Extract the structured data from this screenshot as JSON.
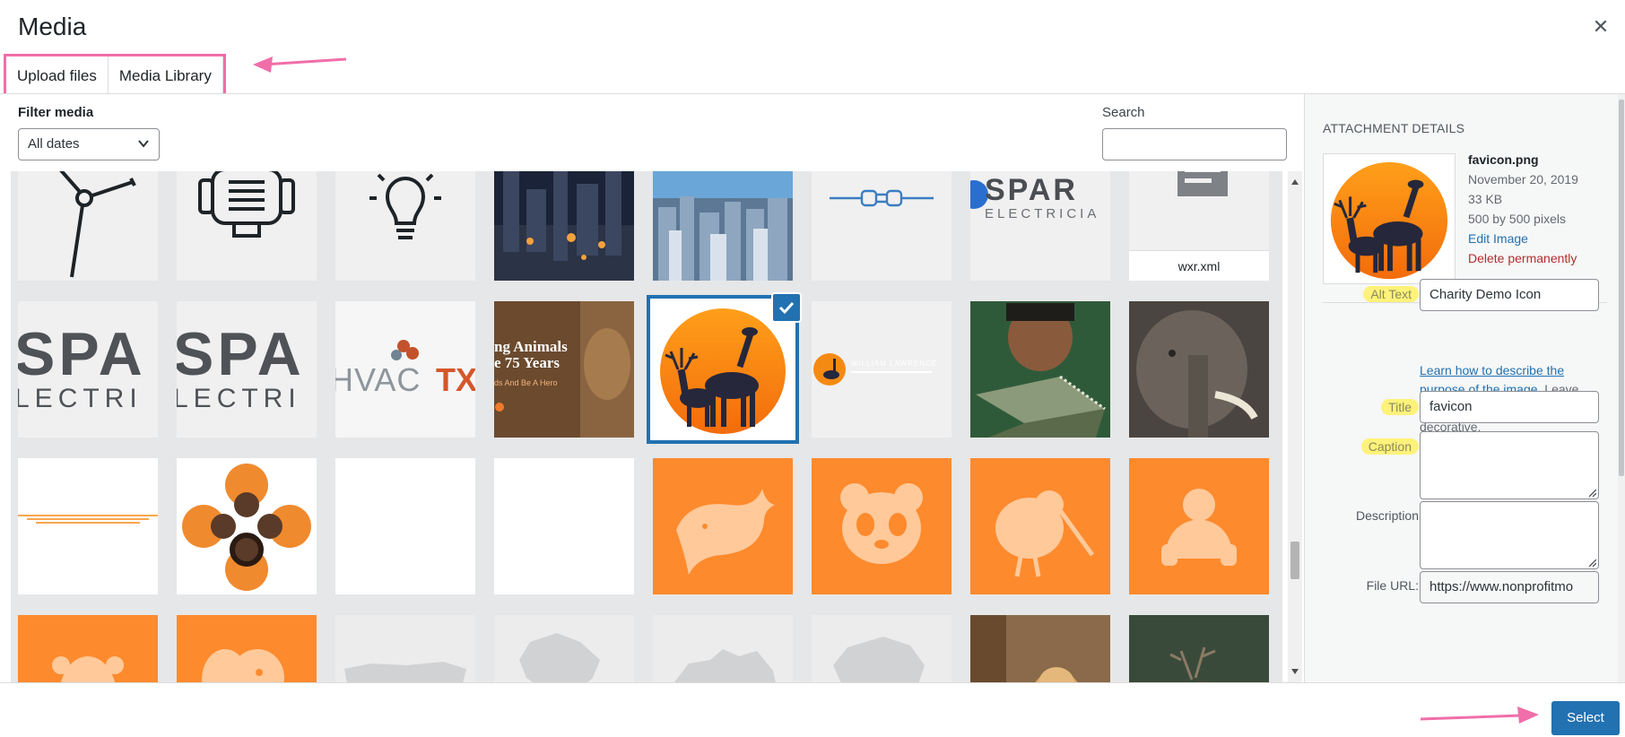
{
  "modal": {
    "title": "Media",
    "close_icon": "close-icon"
  },
  "tabs": [
    {
      "label": "Upload files",
      "active": false
    },
    {
      "label": "Media Library",
      "active": true
    }
  ],
  "annotations": {
    "arrow_color": "#f06ea9"
  },
  "toolbar": {
    "filter_label": "Filter media",
    "date_filter_value": "All dates",
    "search_label": "Search",
    "search_value": ""
  },
  "grid": {
    "items": [
      {
        "kind": "wind-turbine-icon"
      },
      {
        "kind": "server-icon"
      },
      {
        "kind": "lightbulb-icon"
      },
      {
        "kind": "city-night-photo"
      },
      {
        "kind": "city-skyline-photo"
      },
      {
        "kind": "plug-icon"
      },
      {
        "kind": "spar-logo",
        "text": "SPAR",
        "sub": "ELECTRICIA"
      },
      {
        "kind": "file",
        "filename": "wxr.xml"
      },
      {
        "kind": "spar-crop",
        "text": "SPA",
        "sub": "LECTRI"
      },
      {
        "kind": "spar-crop",
        "text": "SPA",
        "sub": "LECTRI"
      },
      {
        "kind": "hvactx-logo",
        "text": "HVACTX"
      },
      {
        "kind": "lion-website",
        "line1": "ng Animals",
        "line2": "e 75 Years",
        "line3": "ds And Be A Hero"
      },
      {
        "kind": "favicon-giraffe",
        "selected": true
      },
      {
        "kind": "wide-logo",
        "text": "WILLIAM LAWRENCE"
      },
      {
        "kind": "crocodile-photo"
      },
      {
        "kind": "elephant-photo"
      },
      {
        "kind": "divider-lines"
      },
      {
        "kind": "people-circle-photo"
      },
      {
        "kind": "blank"
      },
      {
        "kind": "blank"
      },
      {
        "kind": "animal-whale-icon"
      },
      {
        "kind": "animal-panda-icon"
      },
      {
        "kind": "animal-kiwi-icon"
      },
      {
        "kind": "animal-gorilla-icon"
      },
      {
        "kind": "animal-giraffe-icon"
      },
      {
        "kind": "animal-elephant-icon"
      },
      {
        "kind": "map-usa"
      },
      {
        "kind": "map-india"
      },
      {
        "kind": "map-australia"
      },
      {
        "kind": "map-africa"
      },
      {
        "kind": "lioness-photo"
      },
      {
        "kind": "deer-photo"
      }
    ]
  },
  "attachment": {
    "heading": "ATTACHMENT DETAILS",
    "filename": "favicon.png",
    "date": "November 20, 2019",
    "size": "33 KB",
    "dimensions": "500 by 500 pixels",
    "edit_label": "Edit Image",
    "delete_label": "Delete permanently",
    "alt_label": "Alt Text",
    "alt_value": "Charity Demo Icon",
    "alt_help_link": "Learn how to describe the purpose of the image",
    "alt_help_rest": ". Leave empty if the image is purely decorative.",
    "title_label": "Title",
    "title_value": "favicon",
    "caption_label": "Caption",
    "description_label": "Description",
    "fileurl_label": "File URL:",
    "fileurl_value": "https://www.nonprofitmo"
  },
  "footer": {
    "select_label": "Select"
  },
  "colors": {
    "accent": "#2271b1",
    "orange": "#fd8a2d",
    "highlight": "#fff27a",
    "pink": "#f06ea9"
  }
}
